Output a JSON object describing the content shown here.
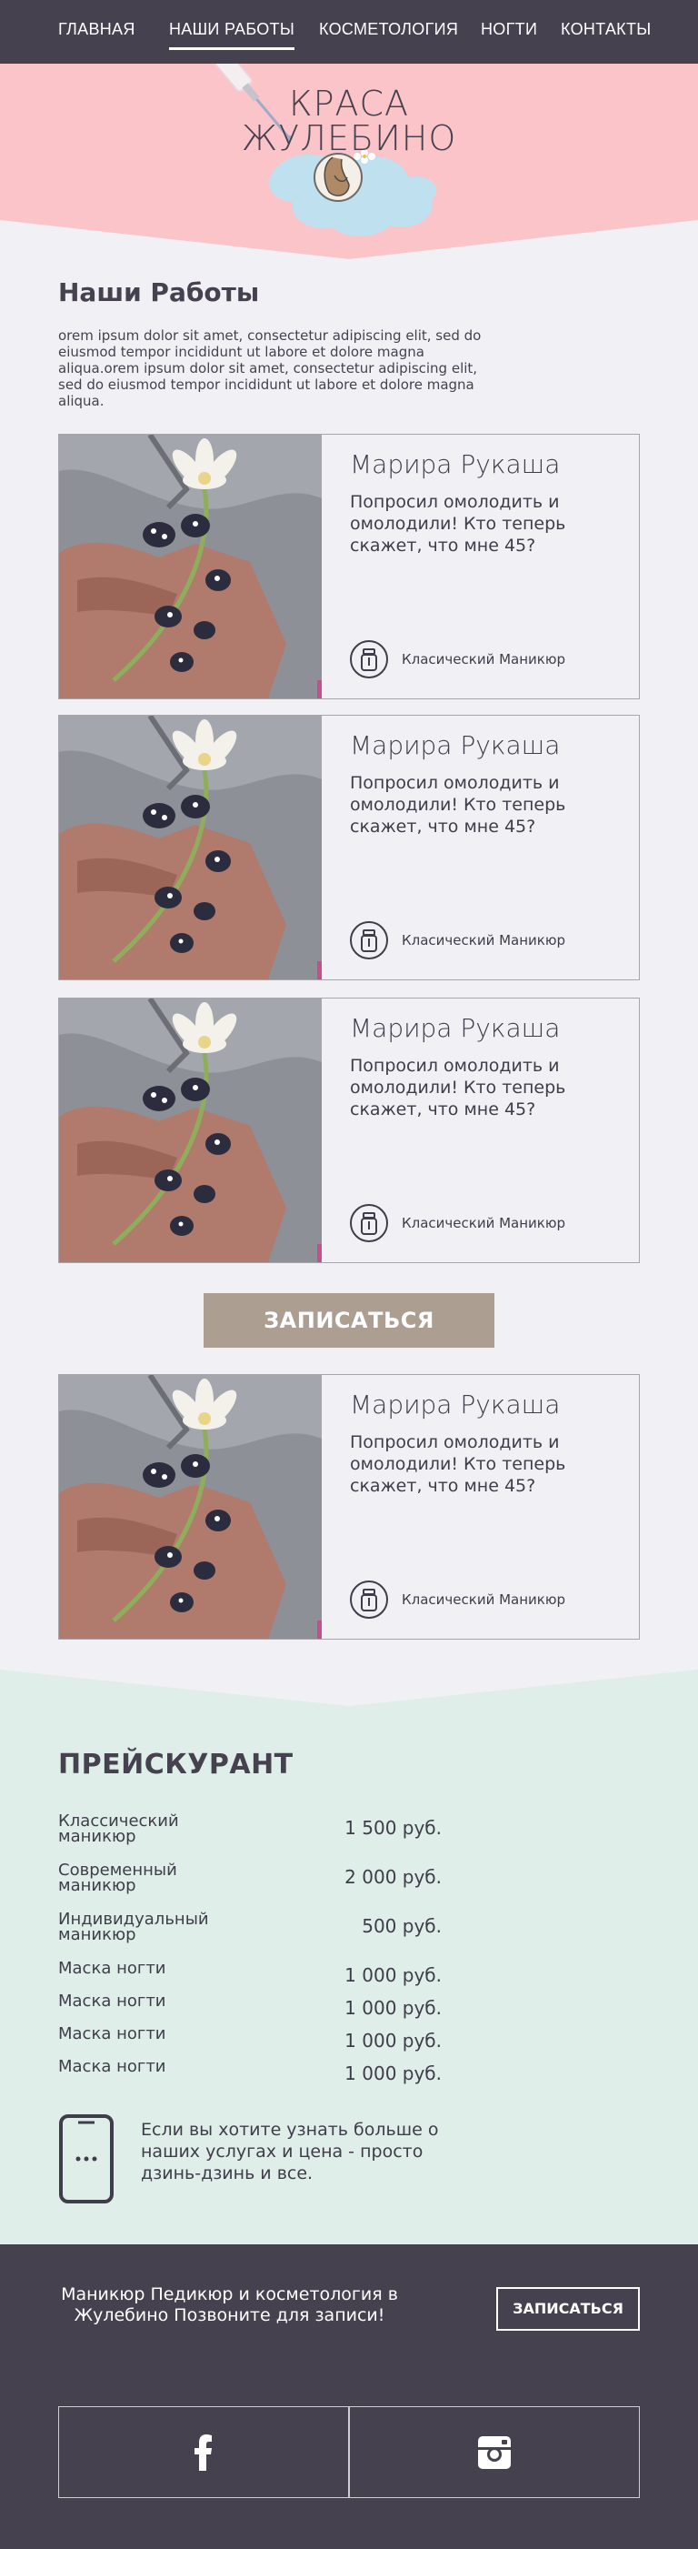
{
  "nav": {
    "items": [
      {
        "label": "ГЛАВНАЯ"
      },
      {
        "label": "НАШИ РАБОТЫ"
      },
      {
        "label": "КОСМЕТОЛОГИЯ"
      },
      {
        "label": "НОГТИ"
      },
      {
        "label": "КОНТАКТЫ"
      }
    ],
    "active": "НАШИ РАБОТЫ"
  },
  "hero": {
    "brand_line1": "КРАСА",
    "brand_line2": "ЖУЛЕБИНО"
  },
  "works": {
    "title": "Наши Работы",
    "text": "orem ipsum dolor sit amet, consectetur adipiscing elit, sed do eiusmod tempor incididunt ut labore et dolore magna aliqua.orem ipsum dolor sit amet, consectetur adipiscing elit, sed do eiusmod tempor incididunt ut labore et dolore magna aliqua.",
    "cards": [
      {
        "name": "Марира Рукаша",
        "quote": "Попросил омолодить и омолодили! Кто теперь скажет, что мне 45?",
        "service": "Класический Маникюр"
      },
      {
        "name": "Марира Рукаша",
        "quote": "Попросил омолодить и омолодили! Кто теперь скажет, что мне 45?",
        "service": "Класический Маникюр"
      },
      {
        "name": "Марира Рукаша",
        "quote": "Попросил омолодить и омолодили! Кто теперь скажет, что мне 45?",
        "service": "Класический Маникюр"
      },
      {
        "name": "Марира Рукаша",
        "quote": "Попросил омолодить и омолодили! Кто теперь скажет, что мне 45?",
        "service": "Класический Маникюр"
      }
    ],
    "book_button": "ЗАПИСАТЬСЯ"
  },
  "prices": {
    "title": "ПРЕЙСКУРАНТ",
    "items": [
      {
        "name": "Классический маникюр",
        "price": "1 500 руб."
      },
      {
        "name": "Современный маникюр",
        "price": "2 000 руб."
      },
      {
        "name": "Индивидуальный маникюр",
        "price": "500 руб."
      },
      {
        "name": "Маска ногти",
        "price": "1 000 руб."
      },
      {
        "name": "Маска ногти",
        "price": "1 000 руб."
      },
      {
        "name": "Маска ногти",
        "price": "1 000 руб."
      },
      {
        "name": "Маска ногти",
        "price": "1 000 руб."
      }
    ],
    "contact_note": "Если вы хотите узнать больше о наших услугах и цена - просто дзинь-дзинь и все."
  },
  "footer": {
    "text": "Маникюр Педикюр и косметология в Жулебино Позвоните для записи!",
    "button": "ЗАПИСАТЬСЯ",
    "social": [
      "facebook-icon",
      "instagram-icon"
    ]
  },
  "colors": {
    "nav_bg": "#45414f",
    "hero_pink": "#fbc4c9",
    "page_bg": "#f1f1f5",
    "button_taupe": "#ad9e92",
    "price_bg": "#dfeee9",
    "footer_bg": "#45414f"
  }
}
